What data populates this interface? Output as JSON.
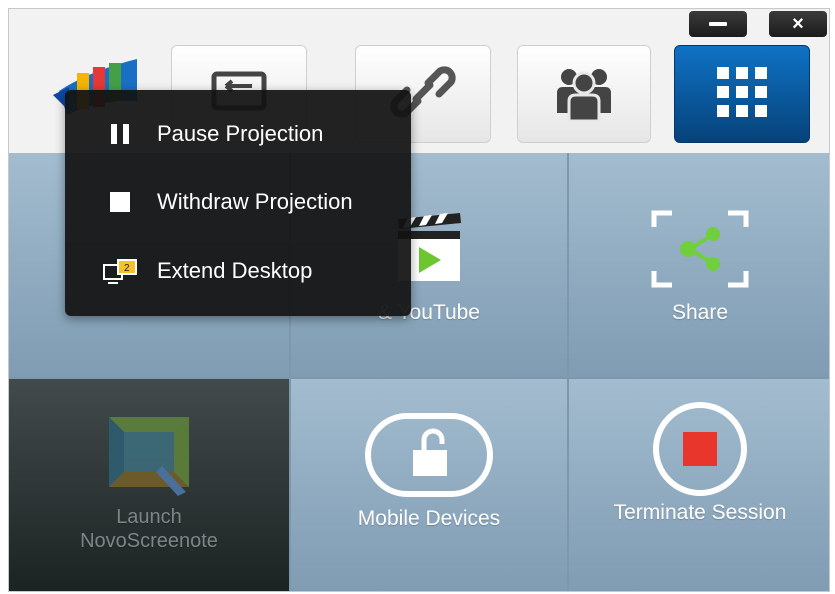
{
  "window": {
    "controls": [
      {
        "name": "minimize",
        "icon": "minimize-icon"
      },
      {
        "name": "close",
        "icon": "close-icon",
        "label": "×"
      }
    ]
  },
  "toolbar": {
    "logo_icon": "novo-logo-icon",
    "buttons": [
      {
        "icon": "projection-mode-icon"
      },
      {
        "icon": "link-icon"
      },
      {
        "icon": "group-users-icon"
      },
      {
        "icon": "grid-apps-icon",
        "active": true
      }
    ]
  },
  "popup_menu": {
    "items": [
      {
        "icon": "pause-icon",
        "label": "Pause Projection"
      },
      {
        "icon": "stop-square-icon",
        "label": "Withdraw Projection"
      },
      {
        "icon": "extend-desktop-icon",
        "label": "Extend Desktop"
      }
    ]
  },
  "tiles": [
    {
      "label": "",
      "icon": "edit-icon"
    },
    {
      "label": "& YouTube",
      "icon": "video-clapper-icon"
    },
    {
      "label": "Share",
      "icon": "share-icon"
    },
    {
      "label": "Launch\nNovoScreenote",
      "label_line1": "Launch",
      "label_line2": "NovoScreenote",
      "icon": "novoscreenote-icon"
    },
    {
      "label": "Mobile Devices",
      "icon": "unlock-icon"
    },
    {
      "label": "Terminate Session",
      "icon": "terminate-icon"
    }
  ],
  "colors": {
    "tile_bg": "#8fabc1",
    "active_button": "#0a5ba3",
    "popup_bg": "#121212",
    "share_green": "#6fcf3d",
    "terminate_red": "#e8362c",
    "play_green": "#6dc630"
  }
}
